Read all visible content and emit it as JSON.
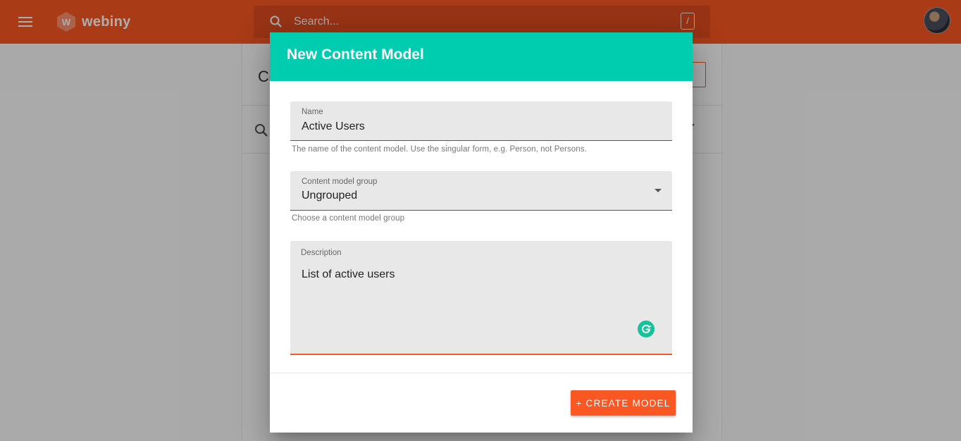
{
  "topbar": {
    "brand": "webiny",
    "search_placeholder": "Search...",
    "search_shortcut": "/",
    "accent_color": "#fa5723"
  },
  "background_page": {
    "title_fragment": "Co"
  },
  "dialog": {
    "title": "New Content Model",
    "header_color": "#00ccb0",
    "name_field": {
      "label": "Name",
      "value": "Active Users",
      "helper": "The name of the content model. Use the singular form, e.g. Person, not Persons."
    },
    "group_field": {
      "label": "Content model group",
      "value": "Ungrouped",
      "helper": "Choose a content model group"
    },
    "description_field": {
      "label": "Description",
      "value": "List of active users"
    },
    "create_button": "+ CREATE MODEL"
  }
}
